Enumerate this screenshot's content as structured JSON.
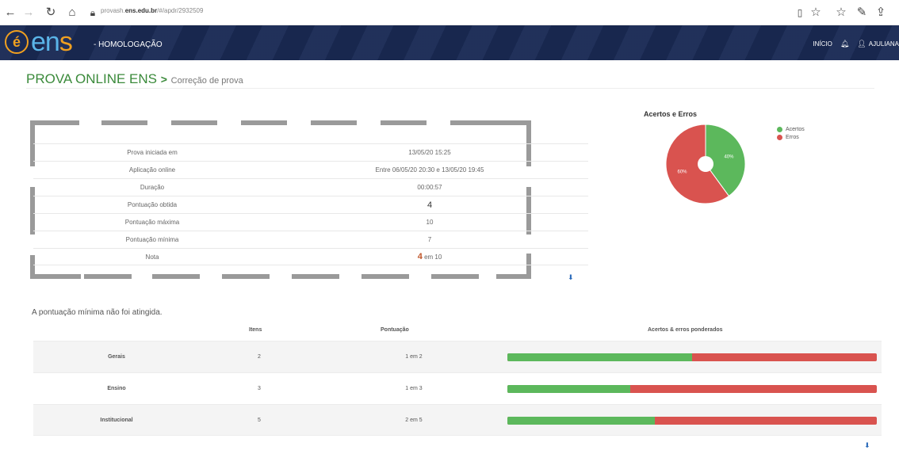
{
  "browser": {
    "url_prefix": "provash.",
    "url_domain": "ens.edu.br",
    "url_path": "/#/apdr/2932509"
  },
  "header": {
    "logo_symbol": "é",
    "logo_text_a": "en",
    "logo_text_b": "s",
    "environment": "- HOMOLOGAÇÃO",
    "inicio": "INÍCIO",
    "user": "AJULIANA"
  },
  "breadcrumb": {
    "title": "PROVA ONLINE ENS",
    "separator": ">",
    "page": "Correção de prova"
  },
  "info": [
    {
      "label": "Prova iniciada em",
      "value": "13/05/20 15:25"
    },
    {
      "label": "Aplicação online",
      "value": "Entre 06/05/20 20:30 e 13/05/20 19:45"
    },
    {
      "label": "Duração",
      "value": "00:00:57"
    },
    {
      "label": "Pontuação obtida",
      "value": "4"
    },
    {
      "label": "Pontuação máxima",
      "value": "10"
    },
    {
      "label": "Pontuação mínima",
      "value": "7"
    },
    {
      "label": "Nota",
      "value_strong": "4",
      "value_rest": "em 10"
    }
  ],
  "chart_data": {
    "type": "pie",
    "title": "Acertos e Erros",
    "categories": [
      "Acertos",
      "Erros"
    ],
    "values": [
      40,
      60
    ],
    "labels": [
      "40%",
      "60%"
    ],
    "colors": [
      "#5cb85c",
      "#d9534f"
    ],
    "legend": "right"
  },
  "message": "A pontuação mínima não foi atingida.",
  "summary": {
    "headers": [
      "Itens",
      "Pontuação",
      "Acertos & erros ponderados"
    ],
    "rows": [
      {
        "name": "Gerais",
        "itens": "2",
        "pontuacao": "1 em 2",
        "ratio": 0.5
      },
      {
        "name": "Ensino",
        "itens": "3",
        "pontuacao": "1 em 3",
        "ratio": 0.333
      },
      {
        "name": "Institucional",
        "itens": "5",
        "pontuacao": "2 em 5",
        "ratio": 0.4
      }
    ]
  },
  "colors": {
    "header_bg": "#1a2a55",
    "title_green": "#3a8a3a",
    "ok": "#5cb85c",
    "err": "#d9534f"
  }
}
